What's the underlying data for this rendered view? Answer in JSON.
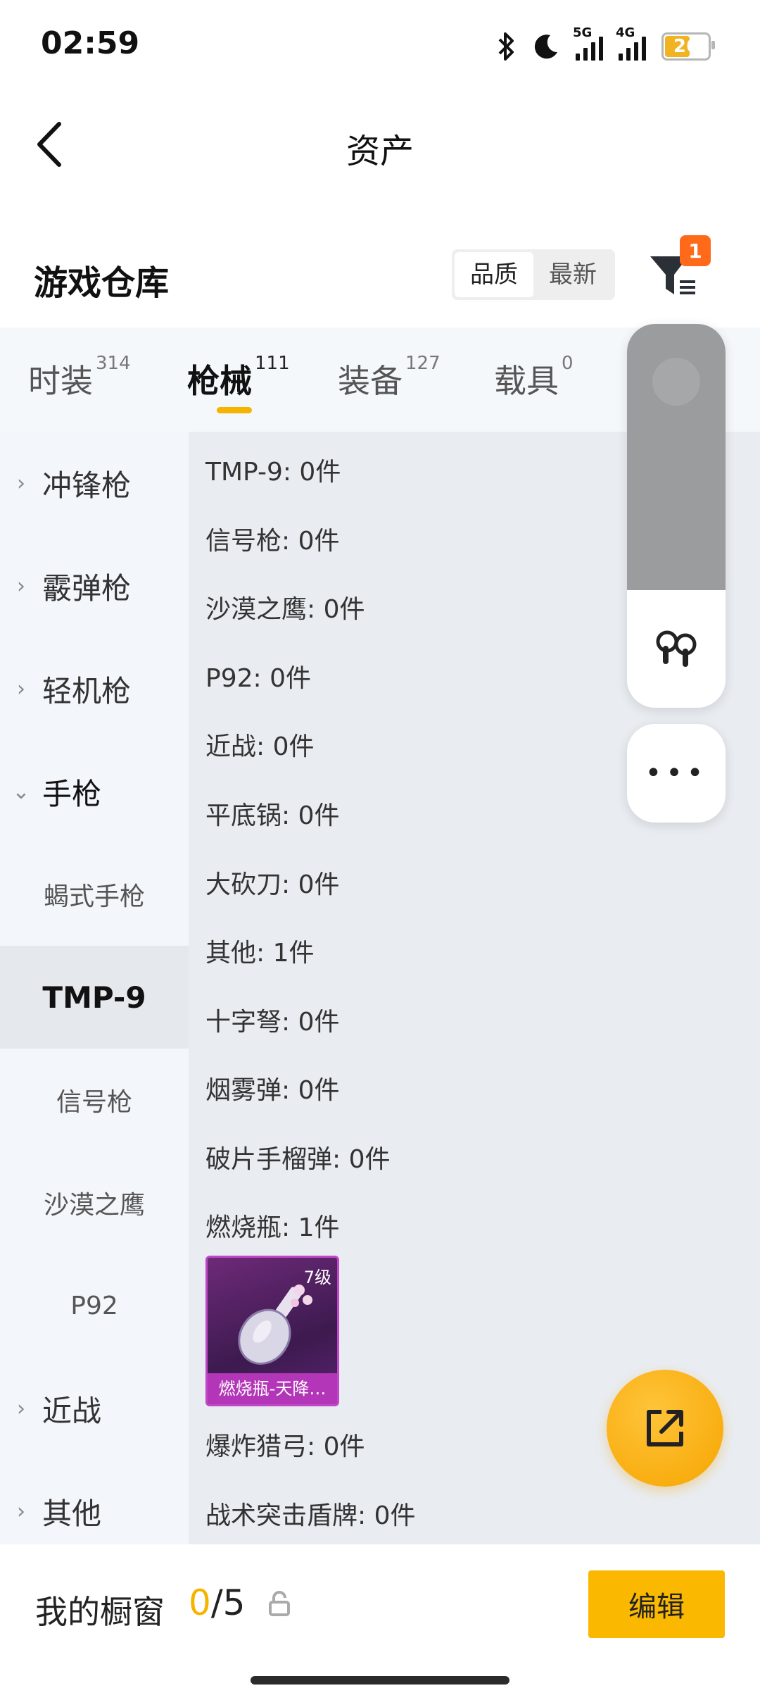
{
  "status_bar": {
    "time": "02:59",
    "network_1": "5G",
    "network_2": "4G",
    "battery": "26",
    "icons": [
      "bluetooth-icon",
      "moon-icon"
    ]
  },
  "header": {
    "title": "资产",
    "back_icon": "chevron-left-icon"
  },
  "warehouse": {
    "title": "游戏仓库",
    "sort_options": [
      "品质",
      "最新"
    ],
    "sort_selected": "品质",
    "filter_badge": "1",
    "filter_icon": "filter-funnel-icon"
  },
  "tabs": [
    {
      "label": "时装",
      "count": "314",
      "active": false
    },
    {
      "label": "枪械",
      "count": "111",
      "active": true
    },
    {
      "label": "装备",
      "count": "127",
      "active": false
    },
    {
      "label": "载具",
      "count": "0",
      "active": false
    }
  ],
  "sidebar": {
    "categories": [
      {
        "label": "冲锋枪",
        "expanded": false
      },
      {
        "label": "霰弹枪",
        "expanded": false
      },
      {
        "label": "轻机枪",
        "expanded": false
      },
      {
        "label": "手枪",
        "expanded": true
      },
      {
        "label": "近战",
        "expanded": false
      },
      {
        "label": "其他",
        "expanded": false
      }
    ],
    "subitems": [
      {
        "label": "蝎式手枪",
        "active": false
      },
      {
        "label": "TMP-9",
        "active": true
      },
      {
        "label": "信号枪",
        "active": false
      },
      {
        "label": "沙漠之鹰",
        "active": false
      },
      {
        "label": "P92",
        "active": false
      }
    ]
  },
  "content": {
    "rows": [
      "TMP-9: 0件",
      "信号枪: 0件",
      "沙漠之鹰: 0件",
      "P92: 0件",
      "近战: 0件",
      "平底锅: 0件",
      "大砍刀: 0件",
      "其他: 1件",
      "十字弩: 0件",
      "烟雾弹: 0件",
      "破片手榴弹: 0件",
      "燃烧瓶: 1件",
      "爆炸猎弓: 0件",
      "战术突击盾牌: 0件"
    ],
    "item_card": {
      "level": "7级",
      "name": "燃烧瓶-天降…",
      "border_color": "#c047c8"
    }
  },
  "floating_panel": {
    "more_label": "•••",
    "icons": [
      "earbuds-icon",
      "more-icon"
    ]
  },
  "share_fab": {
    "icon": "share-out-icon",
    "color": "#f6a500"
  },
  "bottom_bar": {
    "showcase_label": "我的橱窗",
    "showcase_current": "0",
    "showcase_total": "/5",
    "edit_label": "编辑",
    "accent": "#fbb800"
  }
}
